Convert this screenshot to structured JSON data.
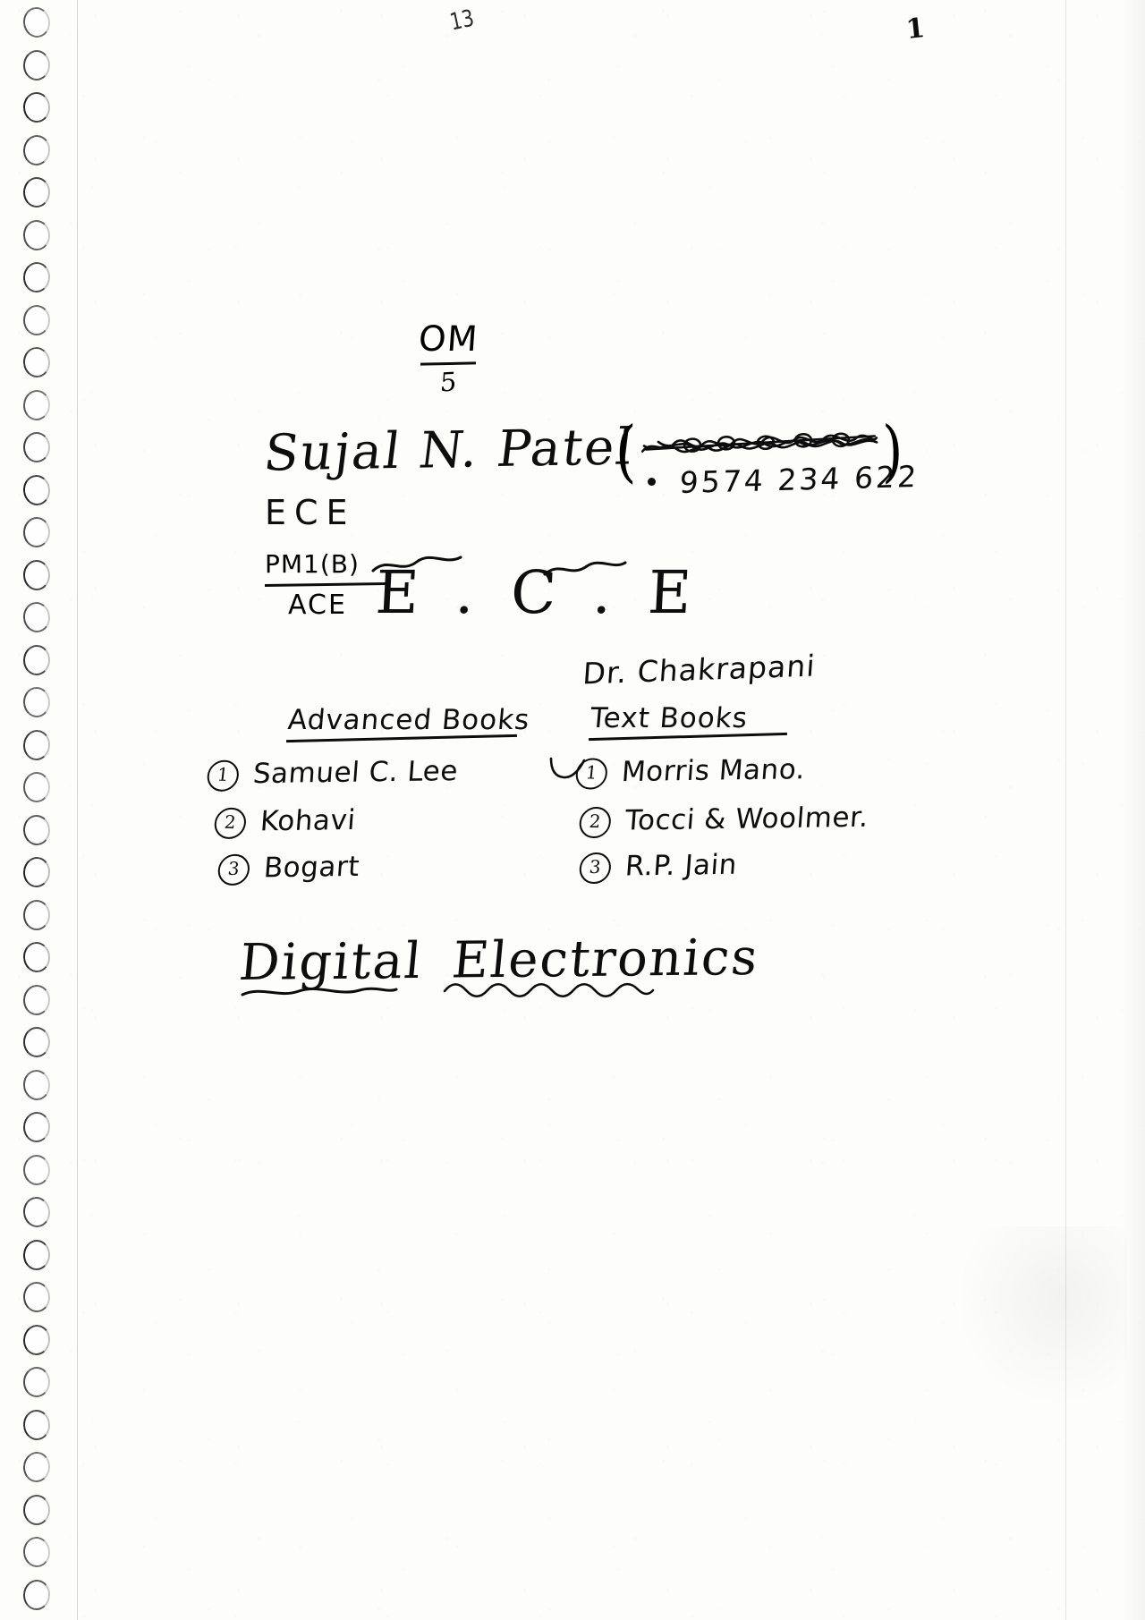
{
  "page": {
    "page_number": "1",
    "top_mark": "13",
    "invocation": {
      "word": "OM",
      "sub": "5"
    }
  },
  "student": {
    "name": "Sujal N. Patel",
    "name_first": "Sujal",
    "name_middle_initial": "N.",
    "name_last": "Patel",
    "paren_open": "(",
    "paren_close": ")",
    "redacted_note": "scribbled-out-number",
    "phone": "9574 234 622",
    "branch": "ECE",
    "batch_top": "PM1(B)",
    "batch_bottom": "ACE",
    "subject_abbrev": "E . C . E"
  },
  "faculty": {
    "label": "Dr. Chakrapani"
  },
  "books": {
    "advanced": {
      "heading": "Advanced Books",
      "items": [
        {
          "num": "1",
          "title": "Samuel C. Lee"
        },
        {
          "num": "2",
          "title": "Kohavi"
        },
        {
          "num": "3",
          "title": "Bogart"
        }
      ]
    },
    "text": {
      "heading": "Text Books",
      "items": [
        {
          "num": "1",
          "title": "Morris Mano."
        },
        {
          "num": "2",
          "title": "Tocci & Woolmer."
        },
        {
          "num": "3",
          "title": "R.P. Jain"
        }
      ]
    }
  },
  "subject": {
    "title": "Digital Electronics",
    "word_1": "Digital",
    "word_2": "Electronics"
  },
  "colors": {
    "ink": "#0d0d0d",
    "paper": "#fdfdfc",
    "hole_outline": "#1b1b1b"
  }
}
